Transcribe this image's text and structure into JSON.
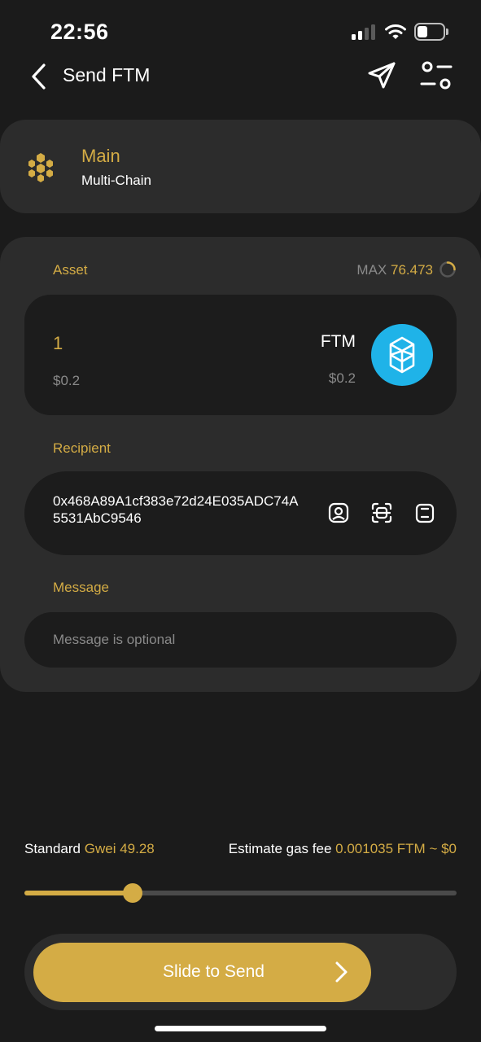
{
  "status_bar": {
    "time": "22:56"
  },
  "header": {
    "title": "Send FTM"
  },
  "wallet": {
    "name": "Main",
    "type": "Multi-Chain"
  },
  "asset": {
    "label": "Asset",
    "max_label": "MAX",
    "max_value": "76.473",
    "amount": "1",
    "amount_usd": "$0.2",
    "token_symbol": "FTM",
    "token_usd": "$0.2"
  },
  "recipient": {
    "label": "Recipient",
    "address": "0x468A89A1cf383e72d24E035ADC74A5531AbC9546"
  },
  "message": {
    "label": "Message",
    "placeholder": "Message is optional"
  },
  "gas": {
    "speed_label": "Standard",
    "gwei_label": "Gwei",
    "gwei_value": "49.28",
    "fee_label": "Estimate gas fee",
    "fee_value": "0.001035 FTM ~ $0",
    "slider_fraction": 0.25
  },
  "send": {
    "slide_label": "Slide to Send"
  },
  "colors": {
    "accent": "#d4ac45",
    "background": "#1b1b1b",
    "card": "#2c2c2c",
    "panel": "#1c1c1c",
    "token": "#1fb3e8"
  },
  "icons": [
    "back-arrow-icon",
    "send-plane-icon",
    "settings-sliders-icon",
    "wallet-hexagon-icon",
    "refresh-icon",
    "fantom-logo-icon",
    "contact-icon",
    "scan-icon",
    "clipboard-icon",
    "chevron-right-icon"
  ]
}
